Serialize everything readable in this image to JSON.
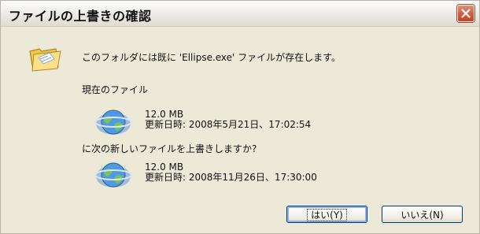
{
  "window": {
    "title": "ファイルの上書きの確認"
  },
  "message": "このフォルダには既に 'Ellipse.exe' ファイルが存在します。",
  "current_label": "現在のファイル",
  "current_file": {
    "size": "12.0 MB",
    "modified": "更新日時: 2008年5月21日、17:02:54"
  },
  "question": "に次の新しいファイルを上書きしますか?",
  "new_file": {
    "size": "12.0 MB",
    "modified": "更新日時: 2008年11月26日、17:30:00"
  },
  "buttons": {
    "yes": "はい(Y)",
    "no": "いいえ(N)"
  },
  "colors": {
    "dialog_bg": "#ece9d8",
    "close_button": "#d35c3d",
    "button_border": "#003c74"
  },
  "icons": {
    "folder": "folder-icon",
    "file": "globe-file-icon",
    "close": "close-icon"
  }
}
